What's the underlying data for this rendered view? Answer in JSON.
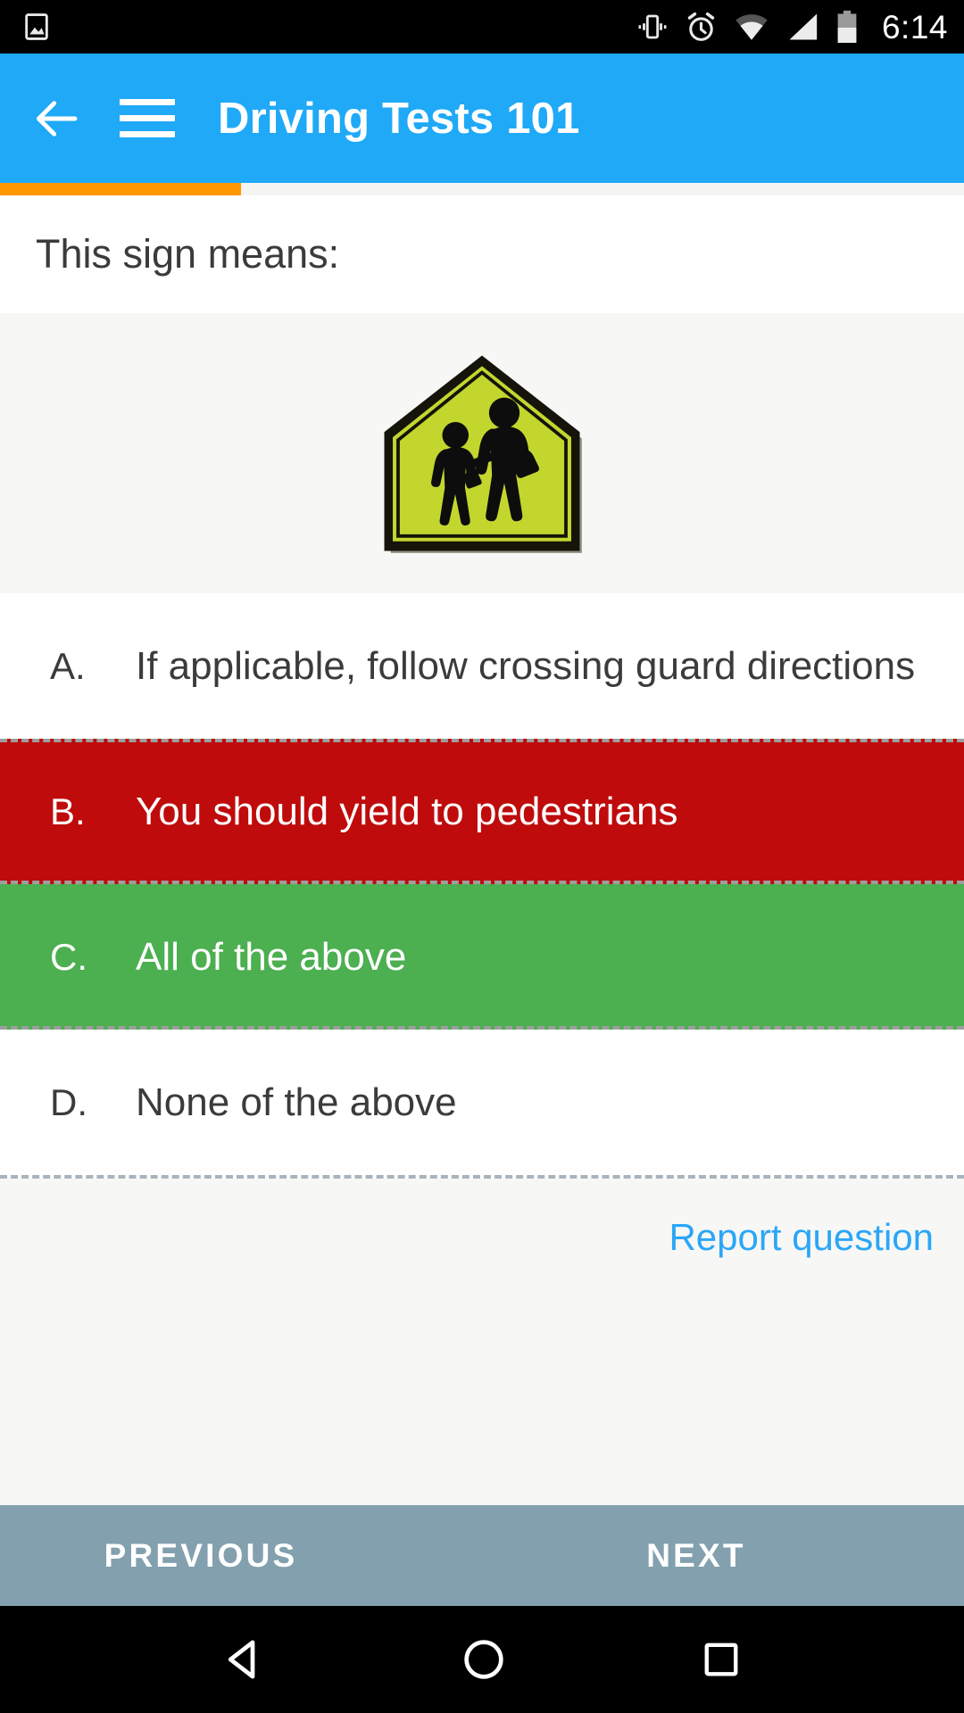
{
  "status_bar": {
    "icons": [
      "image-icon",
      "vibrate-icon",
      "alarm-icon",
      "wifi-icon",
      "cell-signal-icon",
      "battery-icon"
    ],
    "time": "6:14",
    "background_color": "#000000"
  },
  "app_bar": {
    "title": "Driving Tests 101",
    "back_icon": "back-arrow-icon",
    "menu_icon": "hamburger-menu-icon",
    "background_color": "#1fa9f7"
  },
  "progress": {
    "percent": 25,
    "fill_color": "#ff9800",
    "track_color": "#f4f4f2"
  },
  "question": {
    "prompt": "This sign means:",
    "sign": {
      "name": "school-crossing-sign",
      "shape": "pentagon",
      "fill_color": "#c0d72f",
      "border_color": "#111111",
      "figures": "adult-and-child-pedestrians"
    }
  },
  "answers": [
    {
      "letter": "A.",
      "text": "If applicable, follow crossing guard directions",
      "state": "default"
    },
    {
      "letter": "B.",
      "text": "You should yield to pedestrians",
      "state": "wrong"
    },
    {
      "letter": "C.",
      "text": "All of the above",
      "state": "correct"
    },
    {
      "letter": "D.",
      "text": "None of the above",
      "state": "default"
    }
  ],
  "report": {
    "label": "Report question",
    "color": "#2ba6f7"
  },
  "nav": {
    "previous_label": "PREVIOUS",
    "next_label": "NEXT",
    "background_color": "#83a0ae"
  },
  "softkeys": {
    "back": "triangle-back-icon",
    "home": "circle-home-icon",
    "recents": "square-recents-icon"
  },
  "colors": {
    "wrong": "#bf0b0b",
    "correct": "#4caf50",
    "accent": "#1fa9f7",
    "page_bg": "#f7f7f5"
  }
}
